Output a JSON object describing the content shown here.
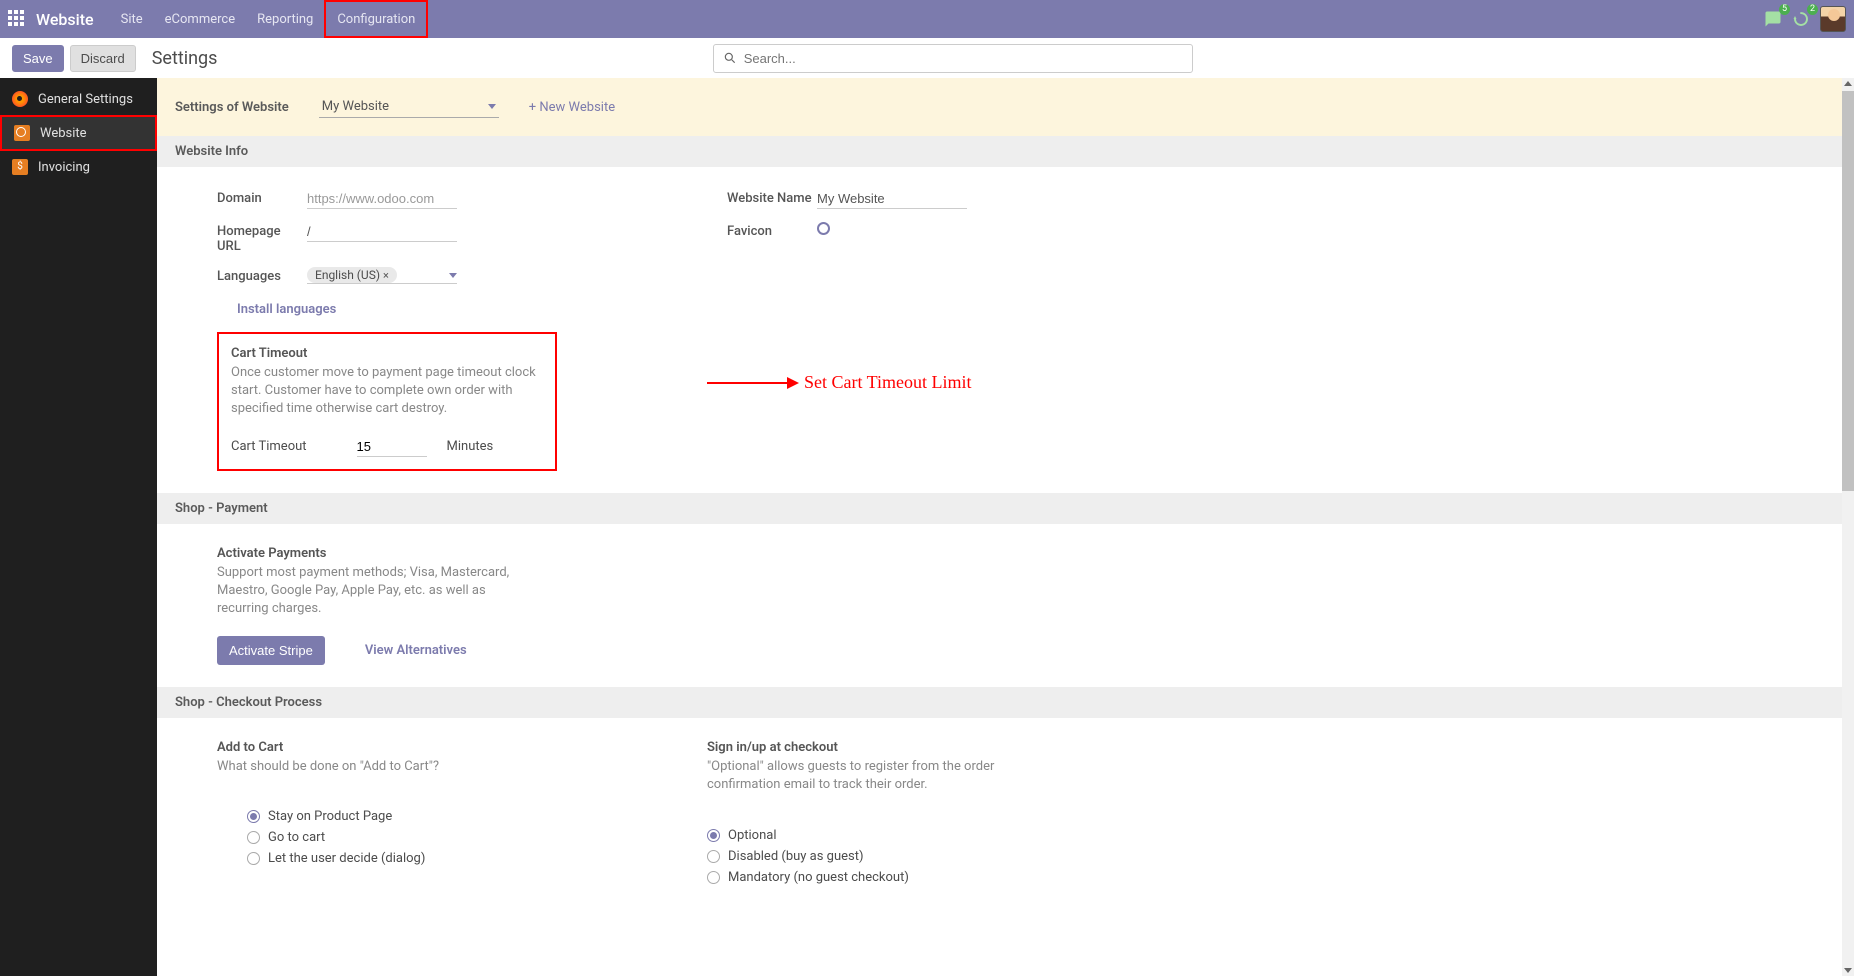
{
  "topnav": {
    "brand": "Website",
    "items": [
      "Site",
      "eCommerce",
      "Reporting",
      "Configuration"
    ],
    "chat_badge": "5",
    "activity_badge": "2"
  },
  "actionbar": {
    "save": "Save",
    "discard": "Discard",
    "title": "Settings",
    "search_placeholder": "Search..."
  },
  "sidebar": {
    "items": [
      {
        "label": "General Settings"
      },
      {
        "label": "Website"
      },
      {
        "label": "Invoicing"
      }
    ]
  },
  "band": {
    "label": "Settings of Website",
    "selected": "My Website",
    "new_link": "+ New Website"
  },
  "section_info": {
    "header": "Website Info",
    "domain_label": "Domain",
    "domain_placeholder": "https://www.odoo.com",
    "homepage_label": "Homepage URL",
    "homepage_value": "/",
    "languages_label": "Languages",
    "language_tag": "English (US)",
    "install_link": "Install languages",
    "website_name_label": "Website Name",
    "website_name_value": "My Website",
    "favicon_label": "Favicon"
  },
  "cart_timeout": {
    "title": "Cart Timeout",
    "desc": "Once customer move to payment page timeout clock start. Customer have to complete own order with specified time otherwise cart destroy.",
    "label": "Cart Timeout",
    "value": "15",
    "unit": "Minutes",
    "annotation": "Set Cart Timeout Limit"
  },
  "section_payment": {
    "header": "Shop - Payment",
    "title": "Activate Payments",
    "desc": "Support most payment methods; Visa, Mastercard, Maestro, Google Pay, Apple Pay, etc. as well as recurring charges.",
    "btn": "Activate Stripe",
    "link": "View Alternatives"
  },
  "section_checkout": {
    "header": "Shop - Checkout Process",
    "addcart_title": "Add to Cart",
    "addcart_desc": "What should be done on \"Add to Cart\"?",
    "addcart_opts": [
      "Stay on Product Page",
      "Go to cart",
      "Let the user decide (dialog)"
    ],
    "signin_title": "Sign in/up at checkout",
    "signin_desc": "\"Optional\" allows guests to register from the order confirmation email to track their order.",
    "signin_opts": [
      "Optional",
      "Disabled (buy as guest)",
      "Mandatory (no guest checkout)"
    ]
  }
}
